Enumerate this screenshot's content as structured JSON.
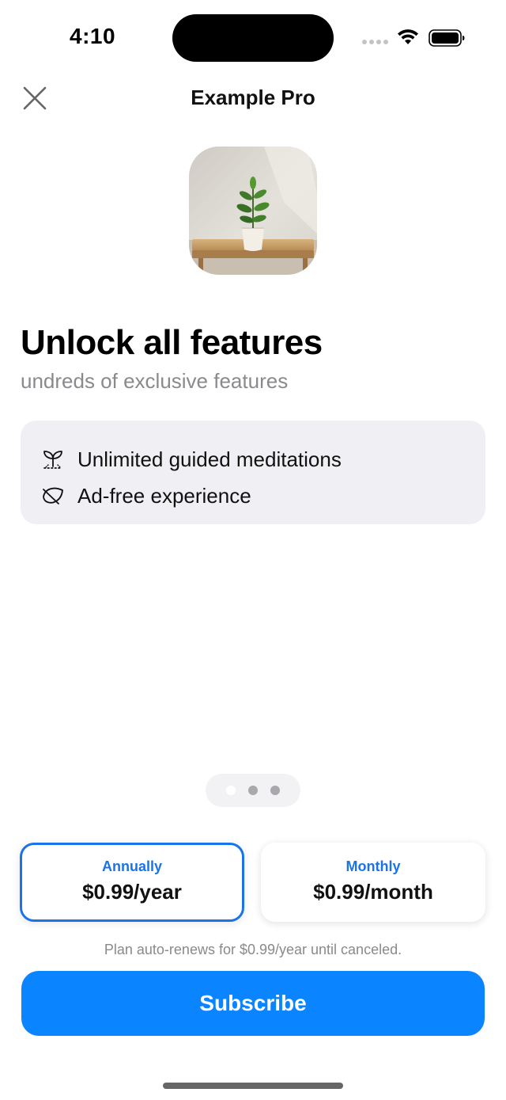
{
  "status_bar": {
    "time": "4:10"
  },
  "nav": {
    "title": "Example Pro",
    "close_icon": "close-icon"
  },
  "hero": {
    "headline": "Unlock all features",
    "subheadline": "undreds of exclusive features"
  },
  "features": [
    {
      "icon": "sprout-icon",
      "label": "Unlimited guided meditations"
    },
    {
      "icon": "leaf-icon",
      "label": "Ad-free experience"
    }
  ],
  "pager": {
    "pages": 3,
    "active_index": 0
  },
  "plans": {
    "annual": {
      "name": "Annually",
      "price": "$0.99/year",
      "selected": true
    },
    "monthly": {
      "name": "Monthly",
      "price": "$0.99/month",
      "selected": false
    }
  },
  "renew_note": "Plan auto-renews for $0.99/year until canceled.",
  "subscribe_label": "Subscribe",
  "colors": {
    "accent": "#0a84ff",
    "plan_accent": "#1a73e8",
    "secondary_text": "#8a8a8e",
    "feature_card_bg": "#f0f0f4"
  }
}
